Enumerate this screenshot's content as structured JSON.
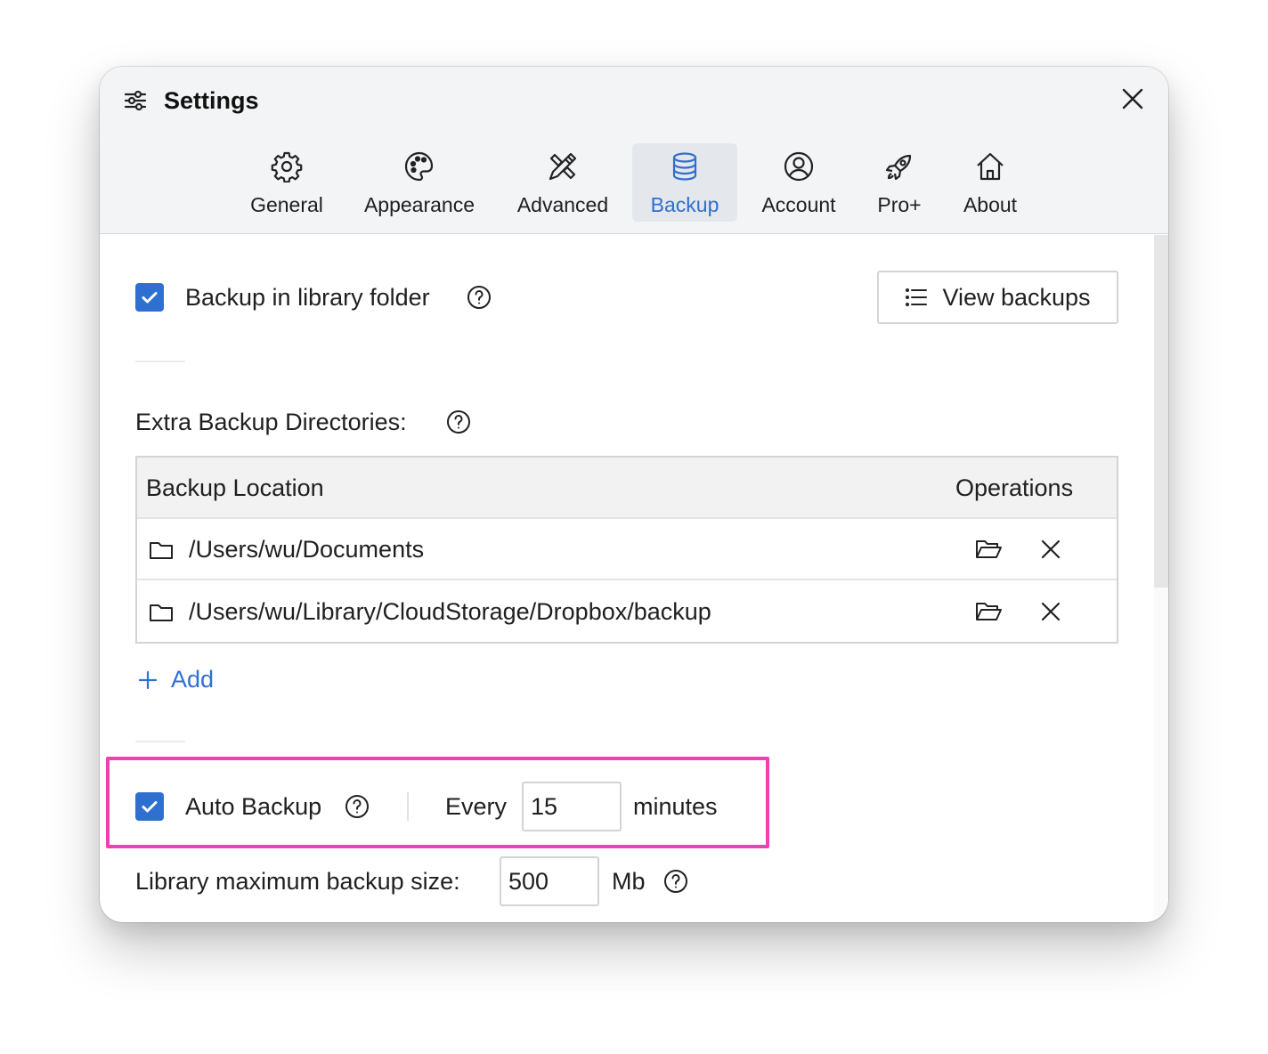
{
  "window": {
    "title": "Settings"
  },
  "tabs": [
    {
      "label": "General",
      "icon": "gear-icon"
    },
    {
      "label": "Appearance",
      "icon": "palette-icon"
    },
    {
      "label": "Advanced",
      "icon": "tools-icon"
    },
    {
      "label": "Backup",
      "icon": "database-icon",
      "active": true
    },
    {
      "label": "Account",
      "icon": "user-circle-icon"
    },
    {
      "label": "Pro+",
      "icon": "rocket-icon"
    },
    {
      "label": "About",
      "icon": "home-icon"
    }
  ],
  "backup": {
    "library_folder": {
      "label": "Backup in library folder",
      "checked": true
    },
    "view_backups_label": "View backups",
    "extra_dirs_label": "Extra Backup Directories:",
    "table": {
      "columns": [
        "Backup Location",
        "Operations"
      ],
      "rows": [
        {
          "path": "/Users/wu/Documents"
        },
        {
          "path": "/Users/wu/Library/CloudStorage/Dropbox/backup"
        }
      ]
    },
    "add_label": "Add",
    "auto_backup": {
      "label": "Auto Backup",
      "checked": true,
      "every_label": "Every",
      "interval": "15",
      "unit": "minutes"
    },
    "max_size": {
      "label": "Library maximum backup size:",
      "value": "500",
      "unit": "Mb"
    }
  },
  "colors": {
    "accent": "#2f6fd0",
    "highlight": "#f03fb0",
    "header_bg": "#f3f4f6",
    "active_tab_bg": "#e4e7ec"
  }
}
